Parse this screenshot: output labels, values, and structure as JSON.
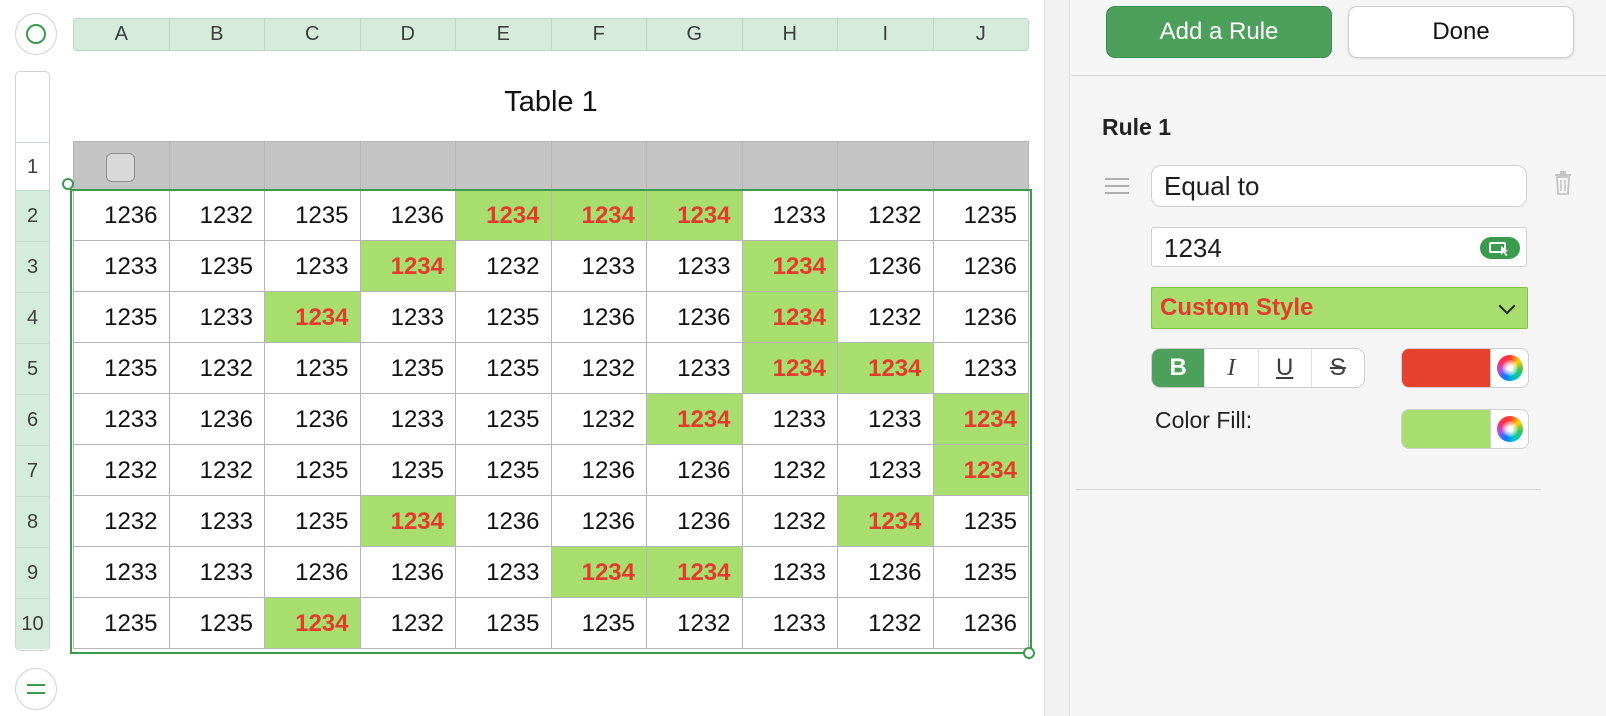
{
  "sheet": {
    "columns": [
      "A",
      "B",
      "C",
      "D",
      "E",
      "F",
      "G",
      "H",
      "I",
      "J"
    ],
    "rows": [
      "1",
      "2",
      "3",
      "4",
      "5",
      "6",
      "7",
      "8",
      "9",
      "10"
    ],
    "table_title": "Table 1",
    "cells": [
      [
        "1236",
        "1232",
        "1235",
        "1236",
        "1234",
        "1234",
        "1234",
        "1233",
        "1232",
        "1235"
      ],
      [
        "1233",
        "1235",
        "1233",
        "1234",
        "1232",
        "1233",
        "1233",
        "1234",
        "1236",
        "1236"
      ],
      [
        "1235",
        "1233",
        "1234",
        "1233",
        "1235",
        "1236",
        "1236",
        "1234",
        "1232",
        "1236"
      ],
      [
        "1235",
        "1232",
        "1235",
        "1235",
        "1235",
        "1232",
        "1233",
        "1234",
        "1234",
        "1233"
      ],
      [
        "1233",
        "1236",
        "1236",
        "1233",
        "1235",
        "1232",
        "1234",
        "1233",
        "1233",
        "1234"
      ],
      [
        "1232",
        "1232",
        "1235",
        "1235",
        "1235",
        "1236",
        "1236",
        "1232",
        "1233",
        "1234"
      ],
      [
        "1232",
        "1233",
        "1235",
        "1234",
        "1236",
        "1236",
        "1236",
        "1232",
        "1234",
        "1235"
      ],
      [
        "1233",
        "1233",
        "1236",
        "1236",
        "1233",
        "1234",
        "1234",
        "1233",
        "1236",
        "1235"
      ],
      [
        "1235",
        "1235",
        "1234",
        "1232",
        "1235",
        "1235",
        "1232",
        "1233",
        "1232",
        "1236"
      ]
    ],
    "highlight_value": "1234",
    "colors": {
      "highlight_fill": "#a8de6e",
      "highlight_text": "#e53b2c",
      "accent": "#3a9a4d"
    }
  },
  "panel": {
    "add_rule_label": "Add a Rule",
    "done_label": "Done",
    "rule_title": "Rule 1",
    "condition": "Equal to",
    "value": "1234",
    "style": "Custom Style",
    "format_buttons": [
      "B",
      "I",
      "U",
      "S"
    ],
    "text_color": "#e8402f",
    "color_fill_label": "Color Fill:",
    "fill_color": "#a8de6e"
  }
}
